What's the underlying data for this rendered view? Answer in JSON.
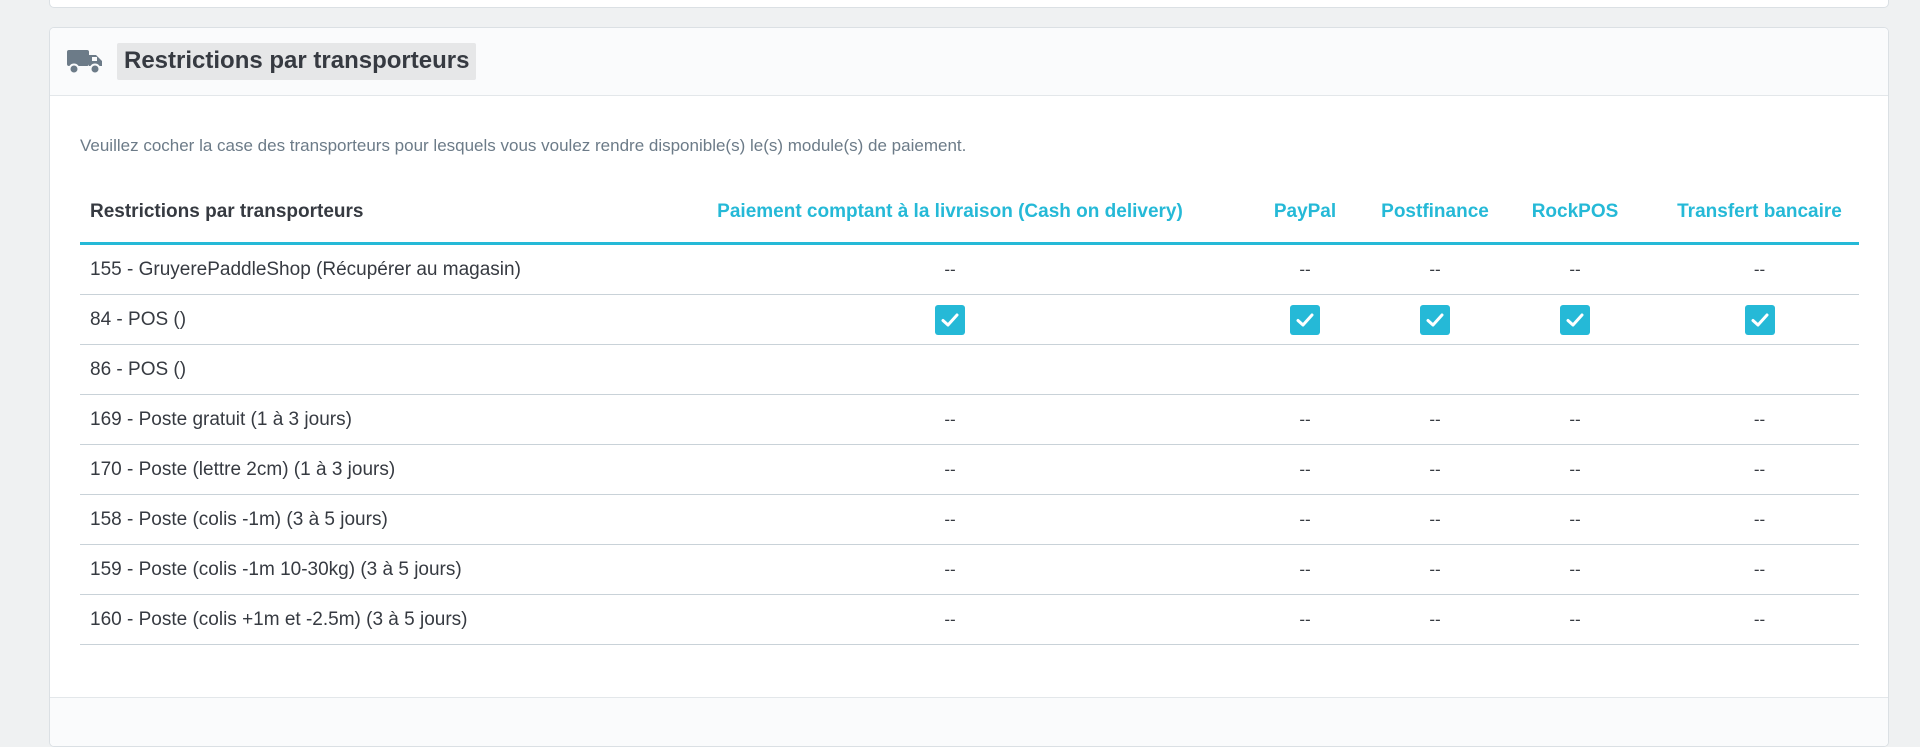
{
  "panel": {
    "title": "Restrictions par transporteurs",
    "help_text": "Veuillez cocher la case des transporteurs pour lesquels vous voulez rendre disponible(s) le(s) module(s) de paiement."
  },
  "table": {
    "columns": [
      "Restrictions par transporteurs",
      "Paiement comptant à la livraison (Cash on delivery)",
      "PayPal",
      "Postfinance",
      "RockPOS",
      "Transfert bancaire"
    ],
    "rows": [
      {
        "carrier": "155 - GruyerePaddleShop (Récupérer au magasin)",
        "cells": [
          "--",
          "--",
          "--",
          "--",
          "--"
        ]
      },
      {
        "carrier": "84 - POS ()",
        "cells": [
          "checked",
          "checked",
          "checked",
          "checked",
          "checked"
        ]
      },
      {
        "carrier": "86 - POS ()",
        "cells": [
          "",
          "",
          "",
          "",
          ""
        ]
      },
      {
        "carrier": "169 - Poste gratuit (1 à 3 jours)",
        "cells": [
          "--",
          "--",
          "--",
          "--",
          "--"
        ]
      },
      {
        "carrier": "170 - Poste (lettre 2cm) (1 à 3 jours)",
        "cells": [
          "--",
          "--",
          "--",
          "--",
          "--"
        ]
      },
      {
        "carrier": "158 - Poste (colis -1m) (3 à 5 jours)",
        "cells": [
          "--",
          "--",
          "--",
          "--",
          "--"
        ]
      },
      {
        "carrier": "159 - Poste (colis -1m 10-30kg) (3 à 5 jours)",
        "cells": [
          "--",
          "--",
          "--",
          "--",
          "--"
        ]
      },
      {
        "carrier": "160 - Poste (colis +1m et -2.5m) (3 à 5 jours)",
        "cells": [
          "--",
          "--",
          "--",
          "--",
          "--"
        ]
      }
    ]
  },
  "icons": {
    "heading_icon": "truck-icon",
    "checkbox_icon": "checkmark-icon"
  },
  "colors": {
    "accent": "#25b9d7",
    "text": "#363a41",
    "muted_text": "#6c7b88"
  }
}
